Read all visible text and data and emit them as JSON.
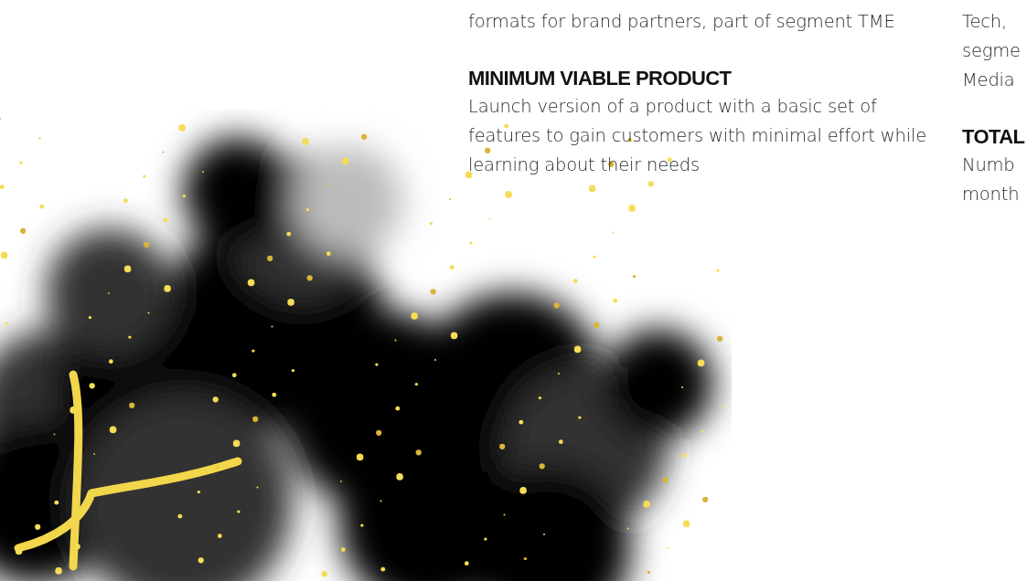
{
  "columns": [
    {
      "entries": [
        {
          "text": "formats for brand partners, part of segment TME"
        },
        {
          "term": "MINIMUM VIABLE PRODUCT",
          "text": "Launch version of a product with a basic set of features to gain customers with minimal effort while learning about their needs"
        }
      ]
    },
    {
      "entries": [
        {
          "text": "Tech, segme Media"
        },
        {
          "term": "TOTAL",
          "text": "Numb month"
        }
      ]
    }
  ]
}
